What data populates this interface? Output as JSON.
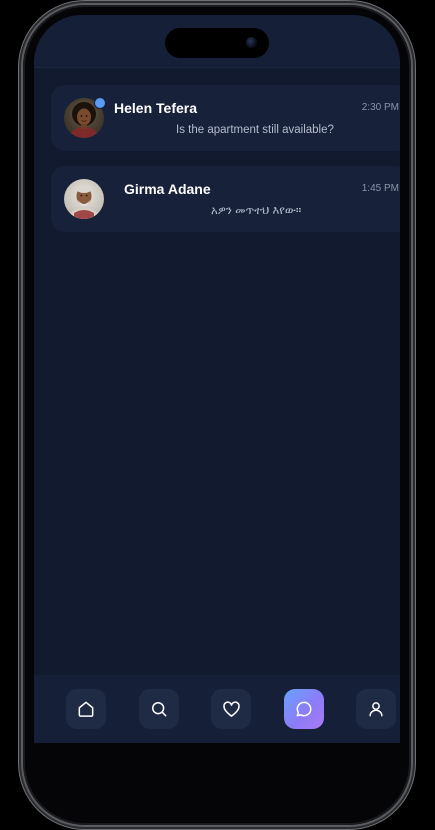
{
  "conversations": [
    {
      "name": "Helen Tefera",
      "time": "2:30 PM",
      "preview": "Is the apartment still available?",
      "online": true
    },
    {
      "name": "Girma Adane",
      "time": "1:45 PM",
      "preview": "አዎን መጥተህ እየው።",
      "online": false
    }
  ],
  "nav": {
    "items": [
      {
        "icon": "home-icon",
        "active": false
      },
      {
        "icon": "search-icon",
        "active": false
      },
      {
        "icon": "heart-icon",
        "active": false
      },
      {
        "icon": "chat-bubble-icon",
        "active": true
      },
      {
        "icon": "user-icon",
        "active": false
      }
    ]
  },
  "colors": {
    "screen_bg": "#111a2e",
    "card_bg": "#17213a",
    "nav_bg": "#152038",
    "online_dot": "#5b9bf3",
    "active_gradient_start": "#6aa2ff",
    "active_gradient_end": "#a97af4"
  }
}
